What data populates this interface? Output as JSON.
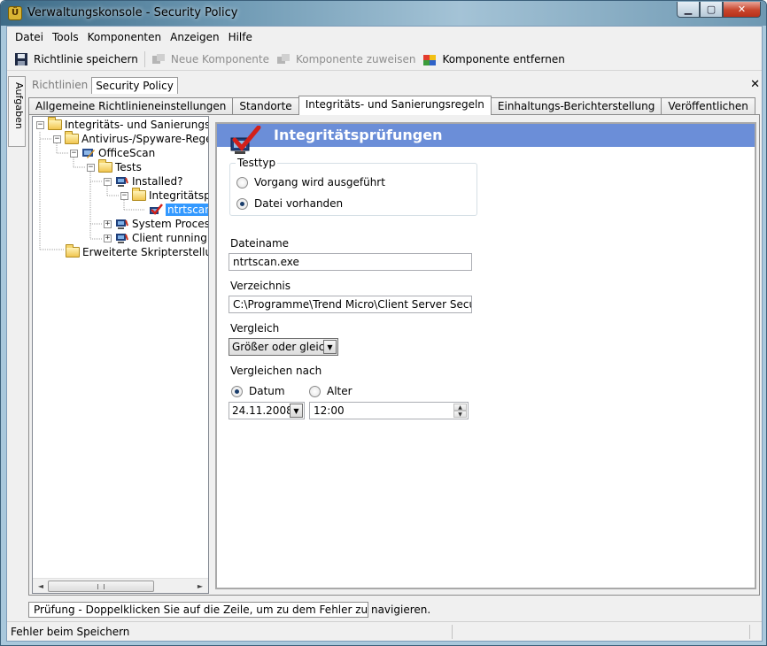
{
  "window": {
    "title": "Verwaltungskonsole - Security Policy",
    "icon_letter": "Ü",
    "controls": [
      "minimize-icon",
      "maximize-icon",
      "close-icon"
    ],
    "minimize_glyph": "▁",
    "maximize_glyph": "▢",
    "close_glyph": "✕"
  },
  "menu": {
    "items": [
      "Datei",
      "Tools",
      "Komponenten",
      "Anzeigen",
      "Hilfe"
    ]
  },
  "toolbar": {
    "buttons": [
      {
        "label": "Richtlinie speichern",
        "icon": "save-icon",
        "enabled": true
      },
      {
        "label": "Neue Komponente",
        "icon": "new-component-icon",
        "enabled": false
      },
      {
        "label": "Komponente zuweisen",
        "icon": "assign-component-icon",
        "enabled": false
      },
      {
        "label": "Komponente entfernen",
        "icon": "remove-component-icon",
        "enabled": true
      }
    ]
  },
  "side_tab": {
    "label": "Aufgaben"
  },
  "doc_tabs": {
    "items": [
      "Richtlinien",
      "Security Policy"
    ],
    "active_index": 1,
    "close_glyph": "✕"
  },
  "tabs": {
    "items": [
      "Allgemeine Richtlinieneinstellungen",
      "Standorte",
      "Integritäts- und Sanierungsregeln",
      "Einhaltungs-Berichterstellung",
      "Veröffentlichen"
    ],
    "active_index": 2
  },
  "tree": {
    "nodes": [
      {
        "label": "Integritäts- und Sanierungsreg",
        "icon": "folder-icon",
        "expander": "−"
      },
      {
        "label": "Antivirus-/Spyware-Regeln",
        "icon": "folder-icon",
        "expander": "−"
      },
      {
        "label": "OfficeScan",
        "icon": "antivirus-component-icon",
        "expander": "−"
      },
      {
        "label": "Tests",
        "icon": "folder-icon",
        "expander": "−"
      },
      {
        "label": "Installed?",
        "icon": "check-component-icon",
        "expander": "−"
      },
      {
        "label": "Integritätspr",
        "icon": "folder-icon",
        "expander": "−"
      },
      {
        "label": "ntrtscan",
        "icon": "integrity-check-icon",
        "expander": "",
        "selected": true
      },
      {
        "label": "System Proces",
        "icon": "check-component-icon",
        "expander": "+"
      },
      {
        "label": "Client running",
        "icon": "check-component-icon",
        "expander": "+"
      },
      {
        "label": "Erweiterte Skripterstellungs",
        "icon": "folder-icon",
        "expander": ""
      }
    ],
    "scroll_left": "◄",
    "scroll_right": "►"
  },
  "detail": {
    "title": "Integritätsprüfungen",
    "header_icon": "checkmark-computer-icon",
    "header_color": "#6b8ed8",
    "testtyp": {
      "legend": "Testtyp",
      "options": [
        "Vorgang wird ausgeführt",
        "Datei vorhanden"
      ],
      "selected_index": 1
    },
    "dateiname": {
      "label": "Dateiname",
      "value": "ntrtscan.exe"
    },
    "verzeichnis": {
      "label": "Verzeichnis",
      "value": "C:\\Programme\\Trend Micro\\Client Server Security"
    },
    "vergleich": {
      "label": "Vergleich",
      "value": "Größer oder gleich"
    },
    "vergleichen_nach": {
      "label": "Vergleichen nach",
      "options": [
        "Datum",
        "Alter"
      ],
      "selected_index": 0,
      "date_value": "24.11.2008",
      "time_value": "12:00"
    }
  },
  "message_strip": {
    "text": "Prüfung - Doppelklicken Sie auf die Zeile, um zu dem Fehler zu navigieren."
  },
  "statusbar": {
    "text": "Fehler beim Speichern"
  }
}
